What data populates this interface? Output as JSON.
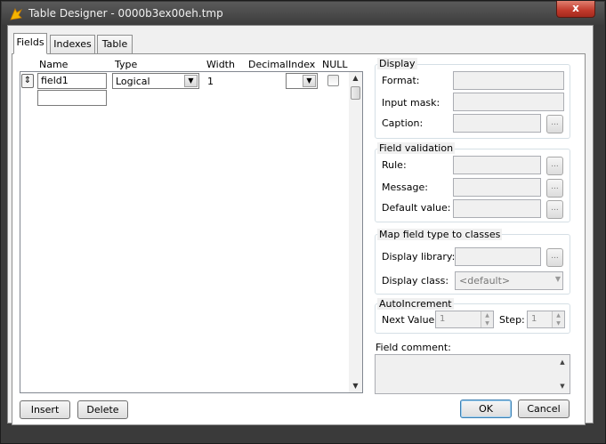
{
  "window": {
    "title": "Table Designer - 0000b3ex00eh.tmp",
    "close_glyph": "x"
  },
  "tabs": [
    {
      "label": "Fields",
      "active": true
    },
    {
      "label": "Indexes",
      "active": false
    },
    {
      "label": "Table",
      "active": false
    }
  ],
  "grid": {
    "columns": [
      "Name",
      "Type",
      "Width",
      "Decimal",
      "Index",
      "NULL"
    ],
    "row": {
      "mover_glyph": "⇕",
      "name": "field1",
      "type": "Logical",
      "width": "1",
      "index": "",
      "null_checked": false
    }
  },
  "display": {
    "title": "Display",
    "format_label": "Format:",
    "input_mask_label": "Input mask:",
    "caption_label": "Caption:"
  },
  "validation": {
    "title": "Field validation",
    "rule_label": "Rule:",
    "message_label": "Message:",
    "default_label": "Default value:"
  },
  "map": {
    "title": "Map field type to classes",
    "library_label": "Display library:",
    "class_label": "Display class:",
    "class_value": "<default>"
  },
  "autoinc": {
    "title": "AutoIncrement",
    "next_label": "Next Value:",
    "step_label": "Step:",
    "next_value": "1",
    "step_value": "1"
  },
  "comment": {
    "label": "Field comment:"
  },
  "ellipsis": "...",
  "buttons": {
    "insert": "Insert",
    "delete": "Delete",
    "ok": "OK",
    "cancel": "Cancel"
  }
}
